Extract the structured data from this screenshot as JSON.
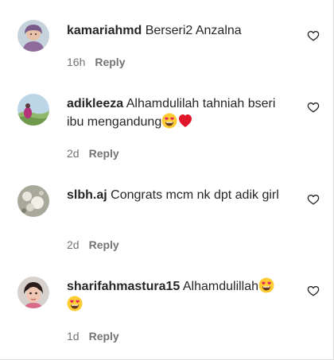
{
  "comments": [
    {
      "username": "kamariahmd",
      "text": "Berseri2 Anzalna",
      "time": "16h",
      "reply_label": "Reply"
    },
    {
      "username": "adikleeza",
      "text": "Alhamdulilah tahniah bseri ibu mengandung",
      "emojis": [
        "heart-eyes-emoji",
        "red-heart-emoji"
      ],
      "time": "2d",
      "reply_label": "Reply"
    },
    {
      "username": "slbh.aj",
      "text": "Congrats mcm nk dpt adik girl",
      "time": "2d",
      "reply_label": "Reply"
    },
    {
      "username": "sharifahmastura15",
      "text": "Alhamdulillah",
      "emojis": [
        "heart-eyes-emoji",
        "heart-eyes-emoji"
      ],
      "time": "1d",
      "reply_label": "Reply"
    }
  ],
  "icons": {
    "like": "heart-outline-icon"
  }
}
